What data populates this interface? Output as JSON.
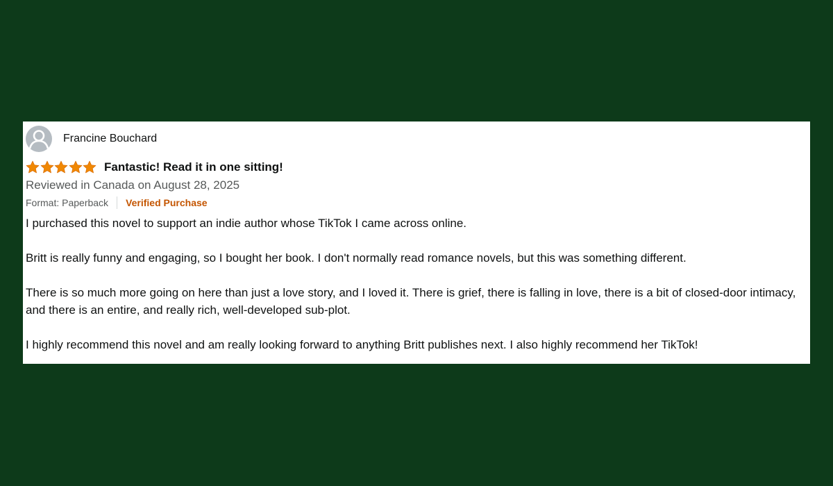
{
  "reviewer": {
    "name": "Francine Bouchard",
    "avatar_icon": "user-silhouette-icon"
  },
  "rating": {
    "stars": 5,
    "max": 5,
    "color": "#f08804"
  },
  "review": {
    "title": "Fantastic! Read it in one sitting!",
    "date": "Reviewed in Canada on August 28, 2025",
    "format": "Format: Paperback",
    "verified": "Verified Purchase",
    "paragraphs": [
      "I purchased this novel to support an indie author whose TikTok I came across online.",
      "Britt is really funny and engaging, so I bought her book. I don't normally read romance novels, but this was something different.",
      "There is so much more going on here than just a love story, and I loved it. There is grief, there is falling in love, there is a bit of closed-door intimacy, and there is an entire, and really rich, well-developed sub-plot.",
      "I highly recommend this novel and am really looking forward to anything Britt publishes next. I also highly recommend her TikTok!"
    ]
  },
  "colors": {
    "background": "#0d3a1a",
    "card": "#ffffff",
    "verified": "#c45500"
  }
}
